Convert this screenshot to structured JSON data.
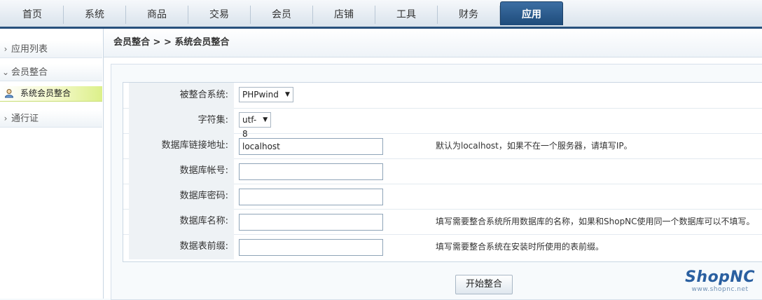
{
  "nav": {
    "tabs": [
      "首页",
      "系统",
      "商品",
      "交易",
      "会员",
      "店铺",
      "工具",
      "财务",
      "应用"
    ],
    "active_index": 8
  },
  "sidebar": {
    "groups": [
      {
        "label": "应用列表",
        "expanded": false
      },
      {
        "label": "会员整合",
        "expanded": true
      },
      {
        "label": "通行证",
        "expanded": false
      }
    ],
    "active_item": "系统会员整合"
  },
  "breadcrumb": "会员整合 > > 系统会员整合",
  "form": {
    "system_label": "被整合系统:",
    "system_value": "PHPwind",
    "charset_label": "字符集:",
    "charset_value": "utf-8",
    "db_host_label": "数据库链接地址:",
    "db_host_value": "localhost",
    "db_host_hint": "默认为localhost，如果不在一个服务器，请填写IP。",
    "db_user_label": "数据库帐号:",
    "db_pass_label": "数据库密码:",
    "db_name_label": "数据库名称:",
    "db_name_hint": "填写需要整合系统所用数据库的名称，如果和ShopNC使用同一个数据库可以不填写。",
    "table_prefix_label": "数据表前缀:",
    "table_prefix_hint": "填写需要整合系统在安装时所使用的表前缀。",
    "submit_label": "开始整合"
  },
  "logo": {
    "name": "ShopNC",
    "url": "www.shopnc.net"
  },
  "colors": {
    "nav_active": "#26507c",
    "sidebar_active": "#dcf08a"
  }
}
